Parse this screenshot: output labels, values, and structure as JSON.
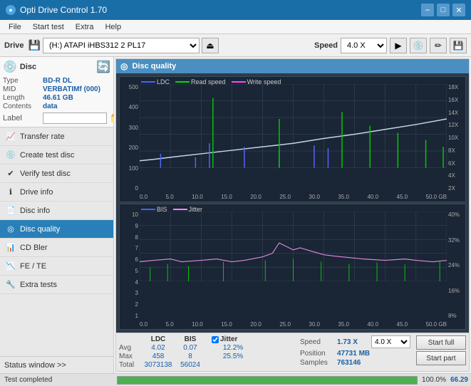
{
  "titlebar": {
    "title": "Opti Drive Control 1.70",
    "icon": "●",
    "minimize": "–",
    "maximize": "□",
    "close": "✕"
  },
  "menubar": {
    "items": [
      "File",
      "Start test",
      "Extra",
      "Help"
    ]
  },
  "toolbar": {
    "drive_label": "Drive",
    "drive_value": "(H:) ATAPI iHBS312  2 PL17",
    "speed_label": "Speed",
    "speed_value": "4.0 X"
  },
  "disc": {
    "label": "Disc",
    "type_key": "Type",
    "type_val": "BD-R DL",
    "mid_key": "MID",
    "mid_val": "VERBATIMf (000)",
    "length_key": "Length",
    "length_val": "46.61 GB",
    "contents_key": "Contents",
    "contents_val": "data",
    "label_key": "Label",
    "label_val": ""
  },
  "nav": {
    "items": [
      {
        "id": "transfer-rate",
        "label": "Transfer rate",
        "icon": "📈"
      },
      {
        "id": "create-test-disc",
        "label": "Create test disc",
        "icon": "💿"
      },
      {
        "id": "verify-test-disc",
        "label": "Verify test disc",
        "icon": "✔"
      },
      {
        "id": "drive-info",
        "label": "Drive info",
        "icon": "ℹ"
      },
      {
        "id": "disc-info",
        "label": "Disc info",
        "icon": "📄"
      },
      {
        "id": "disc-quality",
        "label": "Disc quality",
        "icon": "◎",
        "active": true
      },
      {
        "id": "cd-bler",
        "label": "CD Bler",
        "icon": "📊"
      },
      {
        "id": "fe-te",
        "label": "FE / TE",
        "icon": "📉"
      },
      {
        "id": "extra-tests",
        "label": "Extra tests",
        "icon": "🔧"
      }
    ]
  },
  "status_window": "Status window >>",
  "disc_quality": {
    "title": "Disc quality",
    "chart1": {
      "legend": [
        {
          "name": "LDC",
          "color": "#4444ff"
        },
        {
          "name": "Read speed",
          "color": "#00cc00"
        },
        {
          "name": "Write speed",
          "color": "#ff44ff"
        }
      ],
      "y_left": [
        "500",
        "400",
        "300",
        "200",
        "100",
        "0"
      ],
      "y_right": [
        "18X",
        "16X",
        "14X",
        "12X",
        "10X",
        "8X",
        "6X",
        "4X",
        "2X"
      ],
      "x_labels": [
        "0.0",
        "5.0",
        "10.0",
        "15.0",
        "20.0",
        "25.0",
        "30.0",
        "35.0",
        "40.0",
        "45.0",
        "50.0 GB"
      ]
    },
    "chart2": {
      "legend": [
        {
          "name": "BIS",
          "color": "#4444ff"
        },
        {
          "name": "Jitter",
          "color": "#ff44ff"
        }
      ],
      "y_left": [
        "10",
        "9",
        "8",
        "7",
        "6",
        "5",
        "4",
        "3",
        "2",
        "1"
      ],
      "y_right": [
        "40%",
        "32%",
        "24%",
        "16%",
        "8%"
      ],
      "x_labels": [
        "0.0",
        "5.0",
        "10.0",
        "15.0",
        "20.0",
        "25.0",
        "30.0",
        "35.0",
        "40.0",
        "45.0",
        "50.0 GB"
      ]
    }
  },
  "stats": {
    "headers": [
      "",
      "LDC",
      "BIS",
      "",
      "Jitter",
      "Speed",
      ""
    ],
    "avg_label": "Avg",
    "avg_ldc": "4.02",
    "avg_bis": "0.07",
    "avg_jitter": "12.2%",
    "max_label": "Max",
    "max_ldc": "458",
    "max_bis": "8",
    "max_jitter": "25.5%",
    "total_label": "Total",
    "total_ldc": "3073138",
    "total_bis": "56024",
    "speed_label": "Speed",
    "speed_val": "1.73 X",
    "speed_dropdown": "4.0 X",
    "position_label": "Position",
    "position_val": "47731 MB",
    "samples_label": "Samples",
    "samples_val": "763146",
    "jitter_checked": true,
    "start_full": "Start full",
    "start_part": "Start part"
  },
  "progress": {
    "percent": 100,
    "percent_text": "100.0%",
    "value_text": "66.29"
  },
  "status": {
    "text": "Test completed"
  }
}
